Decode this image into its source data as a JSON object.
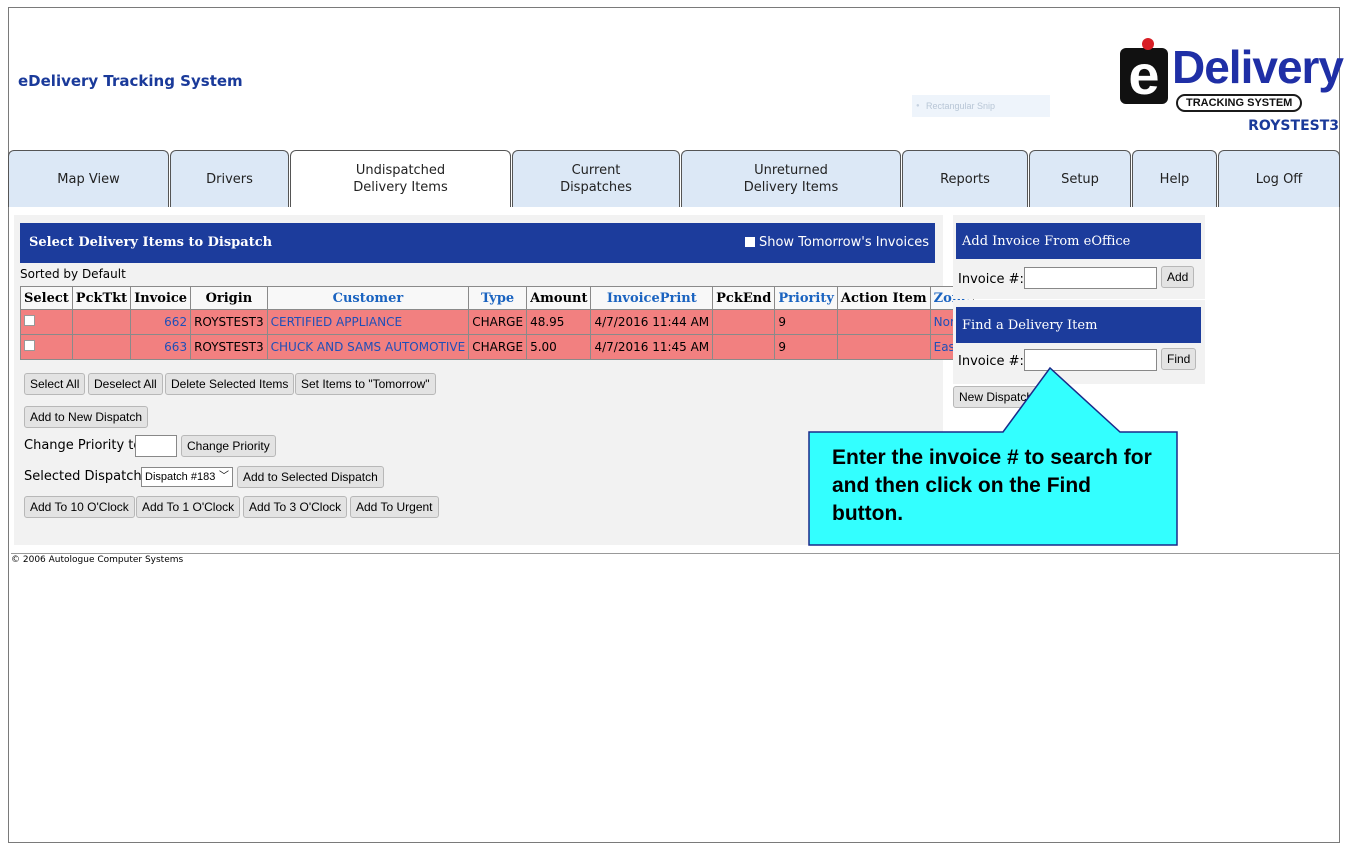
{
  "header": {
    "app_title": "eDelivery Tracking System",
    "ghost_tooltip": "Rectangular Snip",
    "logo_word": "Delivery",
    "logo_letter": "e",
    "logo_sub": "TRACKING SYSTEM",
    "store_name": "ROYSTEST3"
  },
  "tabs": [
    {
      "label": "Map View"
    },
    {
      "label": "Drivers"
    },
    {
      "label": "Undispatched\nDelivery Items",
      "active": true
    },
    {
      "label": "Current\nDispatches"
    },
    {
      "label": "Unreturned\nDelivery Items"
    },
    {
      "label": "Reports"
    },
    {
      "label": "Setup"
    },
    {
      "label": "Help"
    },
    {
      "label": "Log Off"
    }
  ],
  "main": {
    "title": "Select Delivery Items to Dispatch",
    "show_tomorrow_label": "Show Tomorrow's Invoices",
    "sorted_by": "Sorted by Default",
    "columns": [
      "Select",
      "PckTkt",
      "Invoice",
      "Origin",
      "Customer",
      "Type",
      "Amount",
      "InvoicePrint",
      "PckEnd",
      "Priority",
      "Action Item",
      "Zone"
    ],
    "rows": [
      {
        "pcktkt": "",
        "invoice": "662",
        "origin": "ROYSTEST3",
        "customer": "CERTIFIED APPLIANCE",
        "type": "CHARGE",
        "amount": "48.95",
        "invoice_print": "4/7/2016 11:44 AM",
        "pckend": "",
        "priority": "9",
        "action_item": "",
        "zone": "North"
      },
      {
        "pcktkt": "",
        "invoice": "663",
        "origin": "ROYSTEST3",
        "customer": "CHUCK AND SAMS AUTOMOTIVE",
        "type": "CHARGE",
        "amount": "5.00",
        "invoice_print": "4/7/2016 11:45 AM",
        "pckend": "",
        "priority": "9",
        "action_item": "",
        "zone": "East"
      }
    ],
    "buttons": {
      "select_all": "Select All",
      "deselect_all": "Deselect All",
      "delete_selected": "Delete Selected Items",
      "set_tomorrow": "Set Items to \"Tomorrow\"",
      "add_new_dispatch": "Add to New Dispatch",
      "change_priority": "Change Priority",
      "add_selected_dispatch": "Add to Selected Dispatch",
      "add_10": "Add To 10 O'Clock",
      "add_1": "Add To  1 O'Clock",
      "add_3": "Add To  3 O'Clock",
      "add_urgent": "Add To  Urgent"
    },
    "change_priority_label": "Change Priority to:",
    "selected_dispatch_label": "Selected Dispatch:",
    "selected_dispatch_value": "Dispatch #183"
  },
  "side": {
    "add_invoice_title": "Add Invoice From eOffice",
    "invoice_label": "Invoice #:",
    "add_button": "Add",
    "find_title": "Find a Delivery Item",
    "find_invoice_label": "Invoice #:",
    "find_button": "Find",
    "new_dispatch_button": "New Dispatch"
  },
  "callout": {
    "text": "Enter the invoice # to search for and then click on the Find button."
  },
  "footer": {
    "copyright": "© 2006 Autologue Computer Systems"
  },
  "colors": {
    "header_blue": "#1c3c9c",
    "row_red": "#f28080",
    "tab_blue": "#dce8f6",
    "callout_cyan": "#33ffff"
  }
}
